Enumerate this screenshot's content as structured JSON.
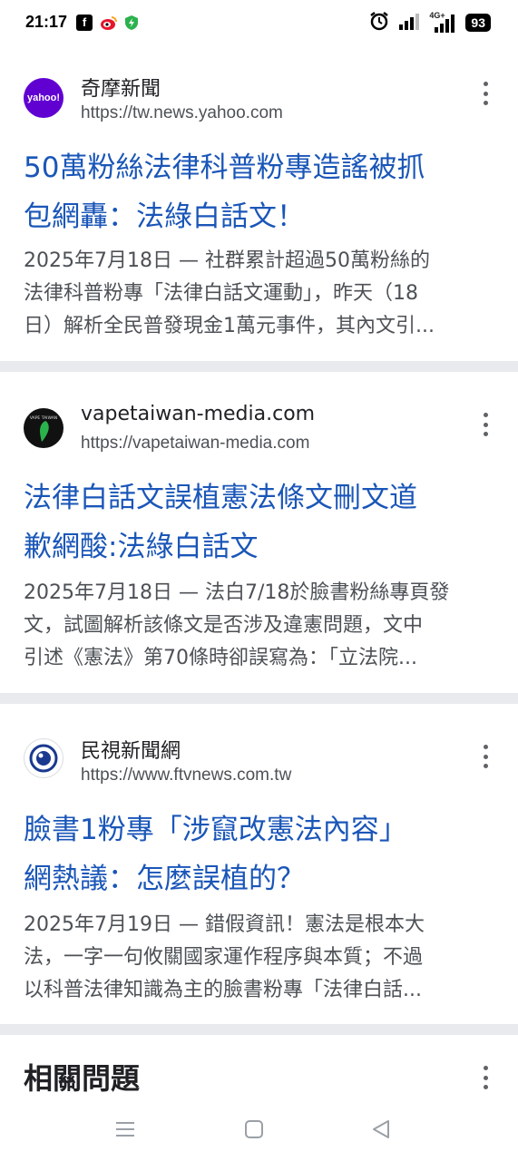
{
  "status_bar": {
    "time": "21:17",
    "fb_glyph": "f",
    "net_label": "4G+",
    "battery": "93",
    "icons": [
      "facebook-icon",
      "weibo-icon",
      "shield-icon",
      "alarm-icon",
      "signal-icon",
      "signal-4g-icon",
      "battery-icon"
    ]
  },
  "results": [
    {
      "site_name": "奇摩新聞",
      "url": "https://tw.news.yahoo.com",
      "logo_text": "yahoo!",
      "logo_color": "#6001d2",
      "title_line1": "50萬粉絲法律科普粉專造謠被抓",
      "title_line2": "包網轟：法綠白話文！",
      "snippet_line1": "2025年7月18日 — 社群累計超過50萬粉絲的",
      "snippet_line2": "法律科普粉專「法律白話文運動」，昨天（18",
      "snippet_line3": "日）解析全民普發現金1萬元事件，其內文引..."
    },
    {
      "site_name": "vapetaiwan-media.com",
      "url": "https://vapetaiwan-media.com",
      "logo_text": "VAPE TAIWAN",
      "logo_color": "#111111",
      "title_line1": "法律白話文誤植憲法條文刪文道",
      "title_line2": "歉網酸:法綠白話文",
      "snippet_line1": "2025年7月18日 — 法白7/18於臉書粉絲專頁發",
      "snippet_line2": "文，試圖解析該條文是否涉及違憲問題，文中",
      "snippet_line3": "引述《憲法》第70條時卻誤寫為：「立法院..."
    },
    {
      "site_name": "民視新聞網",
      "url": "https://www.ftvnews.com.tw",
      "logo_text": "",
      "logo_color": "#1a3a8f",
      "title_line1": "臉書1粉專「涉竄改憲法內容」",
      "title_line2": "網熱議：怎麼誤植的？",
      "snippet_line1": "2025年7月19日 — 錯假資訊！憲法是根本大",
      "snippet_line2": "法，一字一句攸關國家運作程序與本質；不過",
      "snippet_line3": "以科普法律知識為主的臉書粉專「法律白話..."
    }
  ],
  "related_questions": {
    "title": "相關問題"
  },
  "nav_bar": {
    "buttons": [
      "menu-icon",
      "home-icon",
      "back-icon"
    ]
  },
  "colors": {
    "link": "#1a56b8",
    "snippet": "#4d5156",
    "separator": "#e8eaed"
  }
}
